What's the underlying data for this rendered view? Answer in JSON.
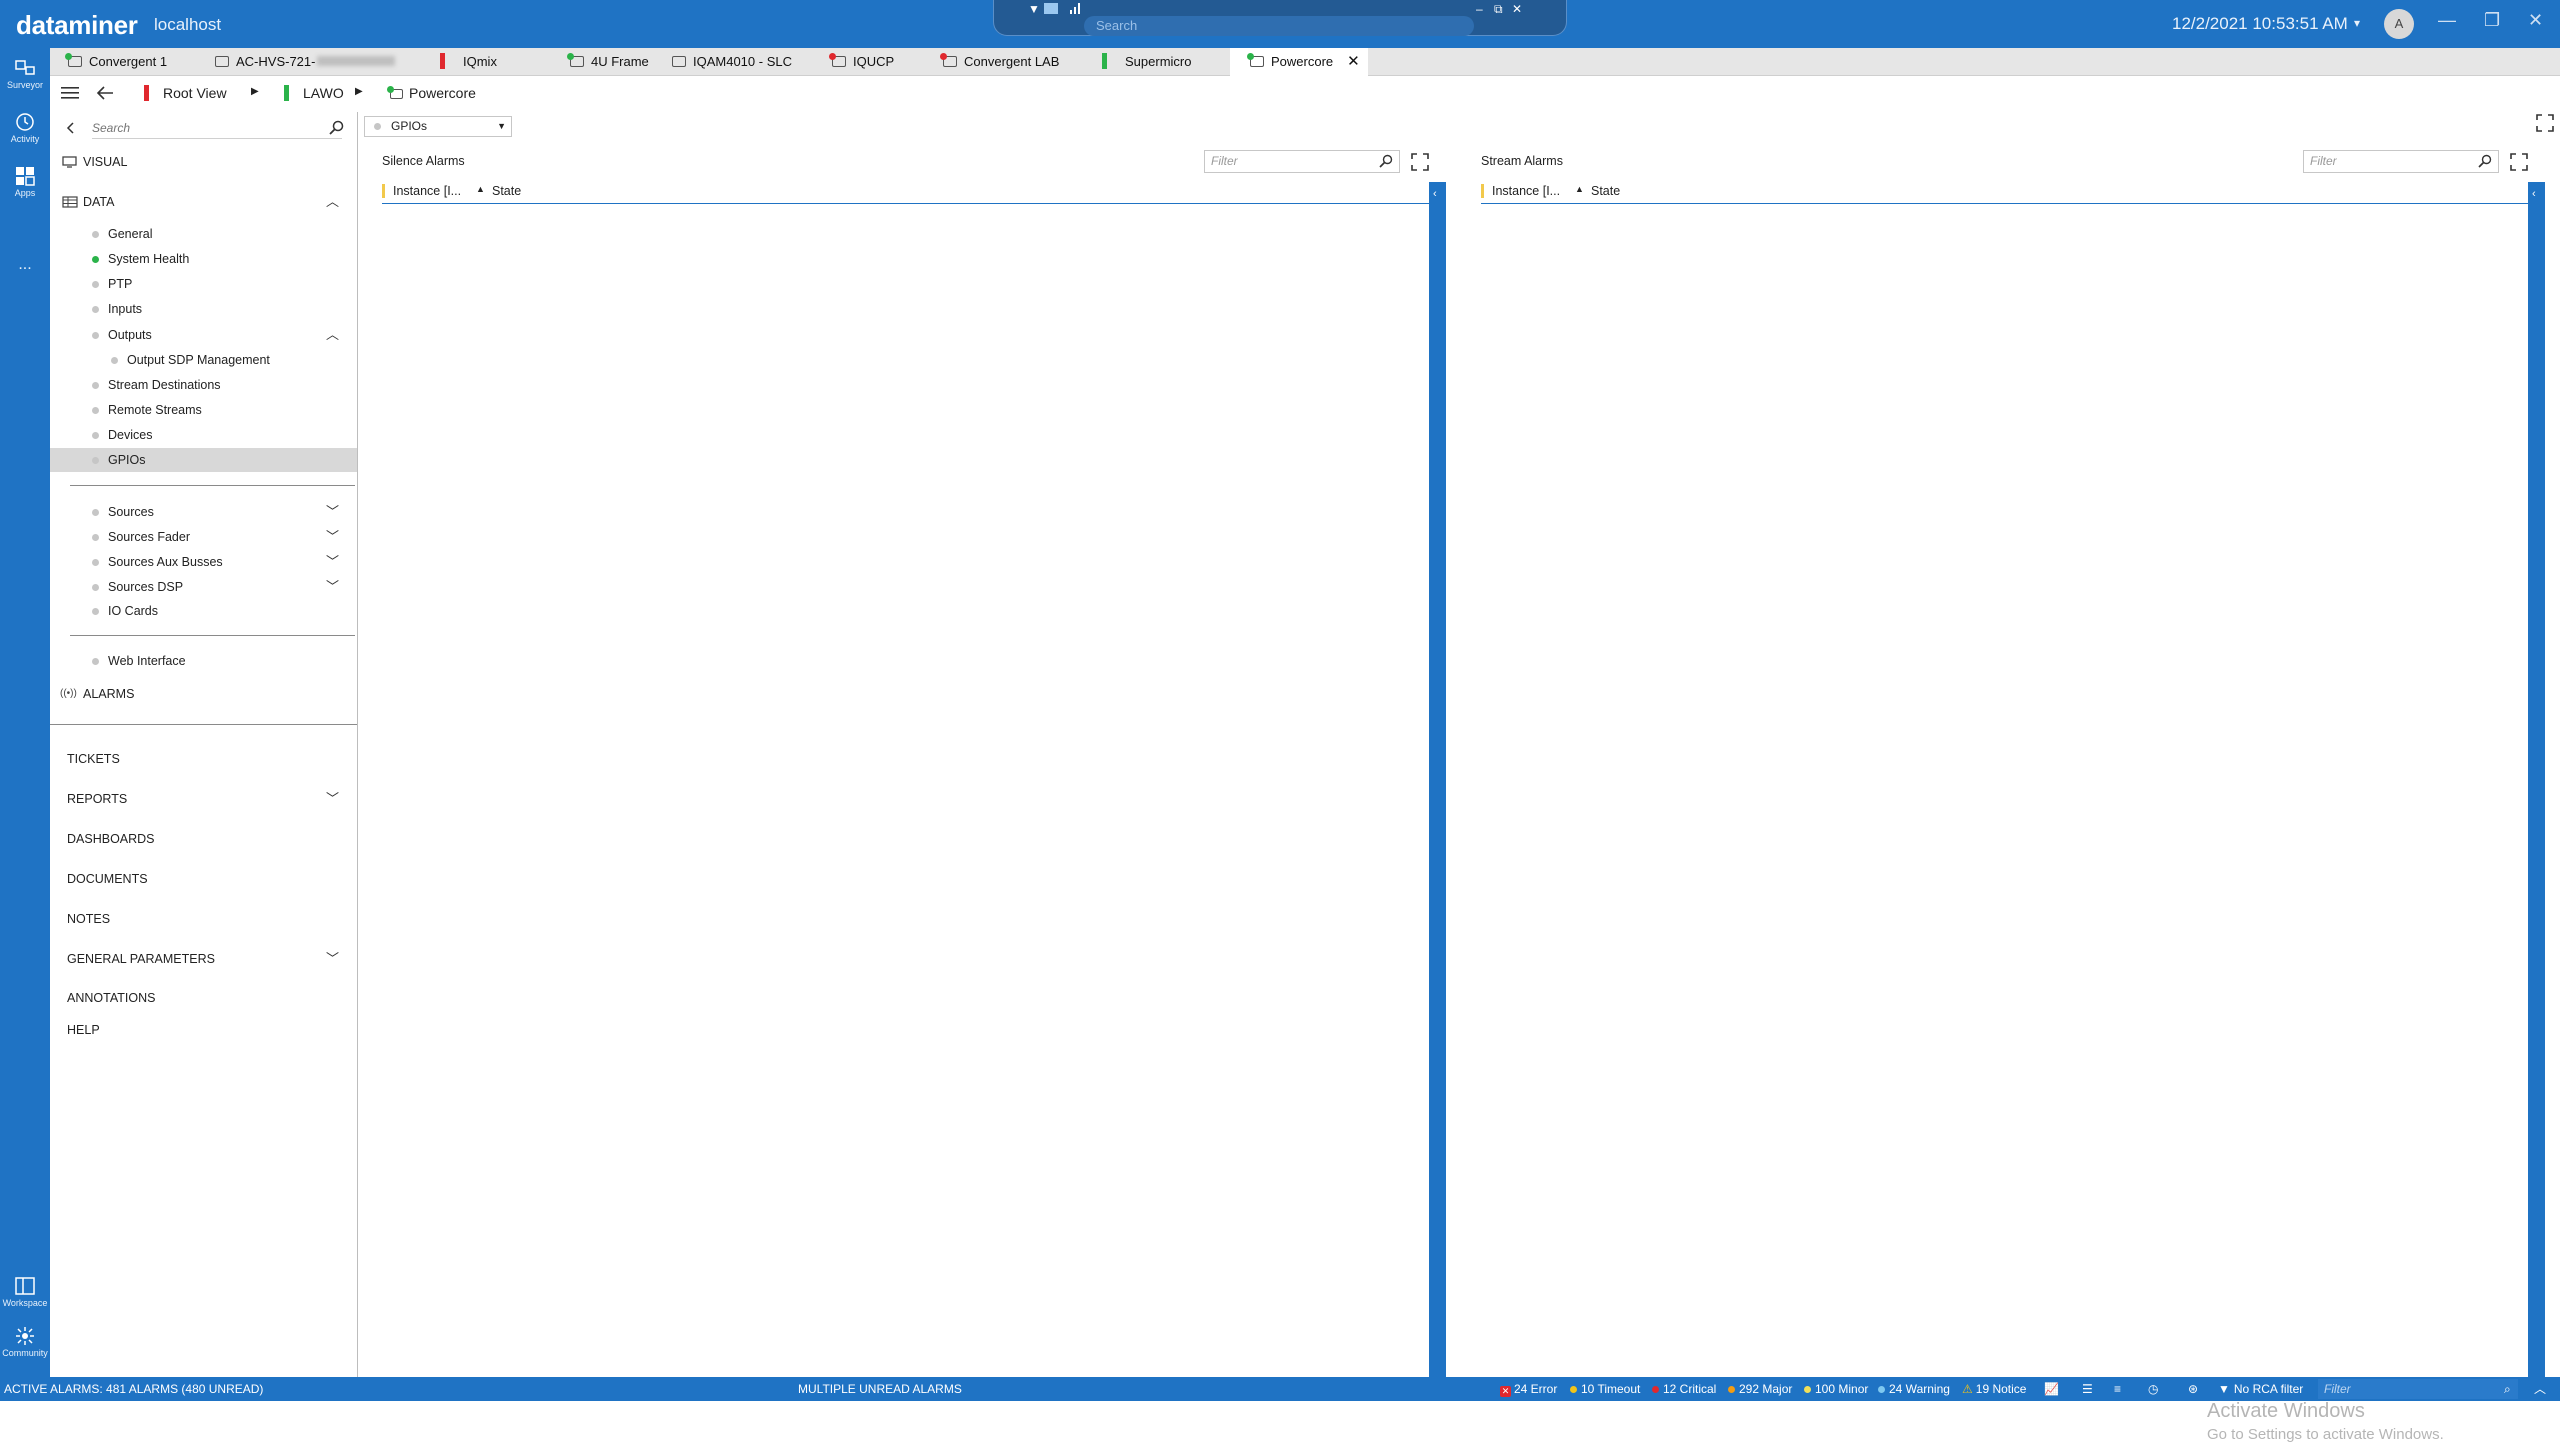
{
  "app": {
    "brand": "dataminer",
    "host": "localhost",
    "search_placeholder": "Search",
    "datetime": "12/2/2021 10:53:51 AM",
    "user_initial": "A"
  },
  "rail": {
    "items": [
      {
        "label": "Surveyor",
        "icon": "surveyor-icon"
      },
      {
        "label": "Activity",
        "icon": "activity-icon"
      },
      {
        "label": "Apps",
        "icon": "apps-icon"
      },
      {
        "label": "...",
        "icon": "more-icon"
      },
      {
        "label": "Workspace",
        "icon": "workspace-icon"
      },
      {
        "label": "Community",
        "icon": "community-icon"
      }
    ]
  },
  "tabs": [
    {
      "label": "Convergent 1",
      "status": "green"
    },
    {
      "label": "AC-HVS-721-",
      "status": "green"
    },
    {
      "label": "IQmix",
      "status": "red"
    },
    {
      "label": "4U Frame",
      "status": "green"
    },
    {
      "label": "IQAM4010 - SLC",
      "status": "grey"
    },
    {
      "label": "IQUCP",
      "status": "red"
    },
    {
      "label": "Convergent LAB",
      "status": "red"
    },
    {
      "label": "Supermicro",
      "status": "green"
    },
    {
      "label": "Powercore",
      "status": "green",
      "active": true
    }
  ],
  "breadcrumb": {
    "items": [
      "Root View",
      "LAWO",
      "Powercore"
    ]
  },
  "sidebar": {
    "search_placeholder": "Search",
    "visual": "VISUAL",
    "data": "DATA",
    "data_items": [
      "General",
      "System Health",
      "PTP",
      "Inputs",
      "Outputs",
      "Output SDP Management",
      "Stream Destinations",
      "Remote Streams",
      "Devices",
      "GPIOs"
    ],
    "group2": [
      "Sources",
      "Sources Fader",
      "Sources Aux Busses",
      "Sources DSP",
      "IO Cards"
    ],
    "group3": [
      "Web Interface"
    ],
    "alarms": "ALARMS",
    "bottom": [
      "TICKETS",
      "REPORTS",
      "DASHBOARDS",
      "DOCUMENTS",
      "NOTES",
      "GENERAL PARAMETERS",
      "ANNOTATIONS",
      "HELP"
    ]
  },
  "main": {
    "page_select": "GPIOs",
    "panels": [
      {
        "title": "Silence Alarms",
        "filter_placeholder": "Filter",
        "col1": "Instance [I...",
        "col2": "State"
      },
      {
        "title": "Stream Alarms",
        "filter_placeholder": "Filter",
        "col1": "Instance [I...",
        "col2": "State"
      }
    ],
    "watermark_title": "Activate Windows",
    "watermark_sub": "Go to Settings to activate Windows."
  },
  "statusbar": {
    "active_alarms": "ACTIVE ALARMS: 481 ALARMS (480 UNREAD)",
    "unread": "MULTIPLE UNREAD ALARMS",
    "severities": [
      {
        "label": "24 Error",
        "color": "#e0282e"
      },
      {
        "label": "10 Timeout",
        "color": "#f0c419"
      },
      {
        "label": "12 Critical",
        "color": "#e0282e"
      },
      {
        "label": "292 Major",
        "color": "#f39c12"
      },
      {
        "label": "100 Minor",
        "color": "#f1e05a"
      },
      {
        "label": "24 Warning",
        "color": "#7ec8f0"
      },
      {
        "label": "19 Notice",
        "color": "#f0c419"
      }
    ],
    "rca": "No RCA filter",
    "filter_placeholder": "Filter"
  },
  "colors": {
    "accent": "#1f73c4",
    "status_green": "#2bb34a",
    "status_red": "#e0282e"
  }
}
